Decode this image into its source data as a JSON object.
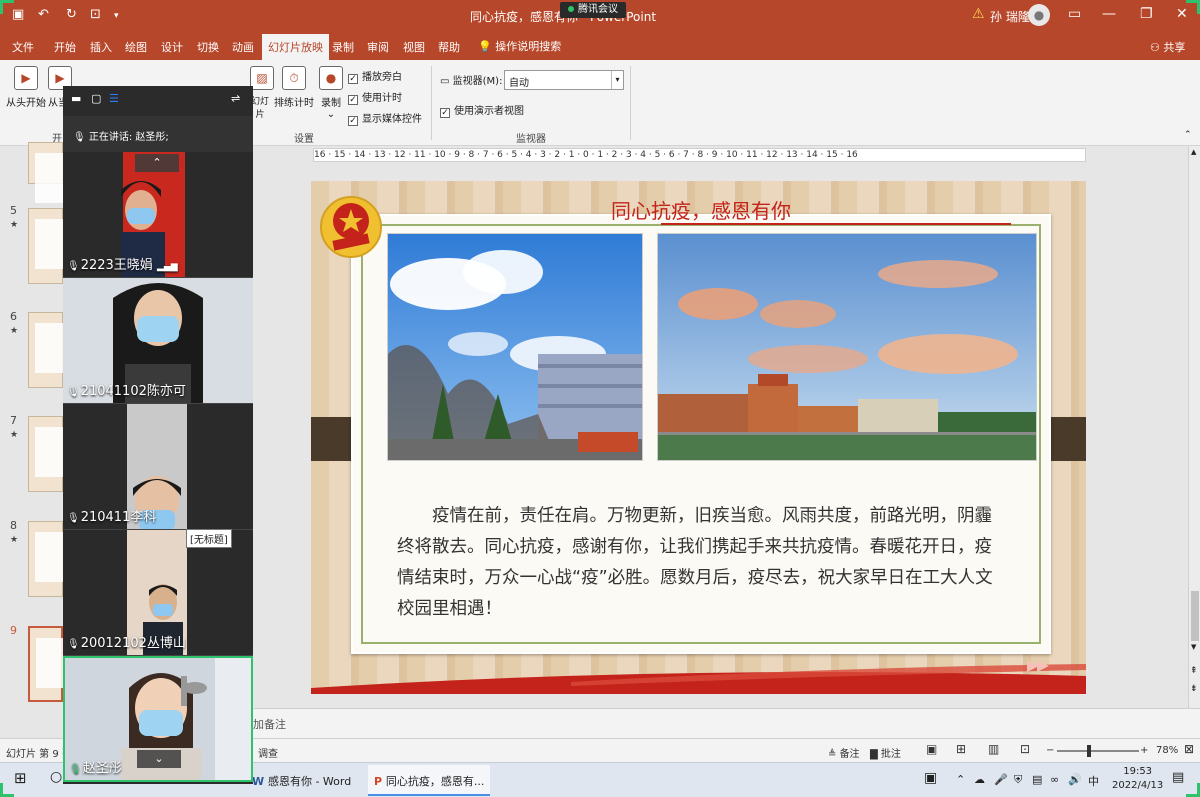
{
  "window": {
    "title": "同心抗疫，感恩有你 - PowerPoint",
    "user": "孙 瑞隆",
    "warning_icon": "warning-icon",
    "meeting_pill": "腾讯会议"
  },
  "tabs": [
    "文件",
    "开始",
    "插入",
    "绘图",
    "设计",
    "切换",
    "动画",
    "幻灯片放映",
    "录制",
    "审阅",
    "视图",
    "帮助"
  ],
  "tab_search": "操作说明搜索",
  "share": "共享",
  "ribbon": {
    "from_start": "从头开始",
    "from_current": "从当",
    "rehearse": "排练计时",
    "record": "录制",
    "hide_slide": "幻灯片",
    "chk_narration": "播放旁白",
    "chk_timing": "使用计时",
    "chk_media": "显示媒体控件",
    "group_setup": "设置",
    "monitor_label": "监视器(M):",
    "monitor_value": "自动",
    "presenter_view": "使用演示者视图",
    "group_monitor": "监视器",
    "group_start": "开"
  },
  "ruler": "16 · 15 · 14 · 13 · 12 · 11 · 10 · 9 · 8 · 7 · 6 · 5 · 4 · 3 · 2 · 1 · 0 · 1 · 2 · 3 · 4 · 5 · 6 · 7 · 8 · 9 · 10 · 11 · 12 · 13 · 14 · 15 · 16",
  "thumbnails": [
    {
      "num": "5",
      "star": "★"
    },
    {
      "num": "6",
      "star": "★"
    },
    {
      "num": "7",
      "star": "★"
    },
    {
      "num": "8",
      "star": "★"
    },
    {
      "num": "9",
      "star": ""
    }
  ],
  "slide": {
    "title": "同心抗疫，感恩有你",
    "text": "疫情在前，责任在肩。万物更新，旧疾当愈。风雨共度，前路光明，阴霾终将散去。同心抗疫，感谢有你，让我们携起手来共抗疫情。春暖花开日，疫情结束时，万众一心战“疫”必胜。愿数月后，疫尽去，祝大家早日在工大人文校园里相遇！"
  },
  "notes_placeholder": "加备注",
  "status": {
    "slide_info": "幻灯片 第 9 张",
    "survey": "调查",
    "notes": "备注",
    "comments": "批注",
    "zoom": "78%"
  },
  "meeting": {
    "speaking_label": "正在讲话: 赵圣彤;",
    "participants": [
      {
        "name": "2223王晓娟"
      },
      {
        "name": "21041102陈亦可"
      },
      {
        "name": "210411李科"
      },
      {
        "name": "20012102丛博山"
      },
      {
        "name": "赵圣彤"
      }
    ],
    "tooltip": "[无标题]"
  },
  "taskbar": {
    "apps": [
      {
        "label": "感恩有你 - Word"
      },
      {
        "label": "同心抗疫，感恩有..."
      }
    ],
    "ime": "中",
    "time": "19:53",
    "date": "2022/4/13"
  }
}
